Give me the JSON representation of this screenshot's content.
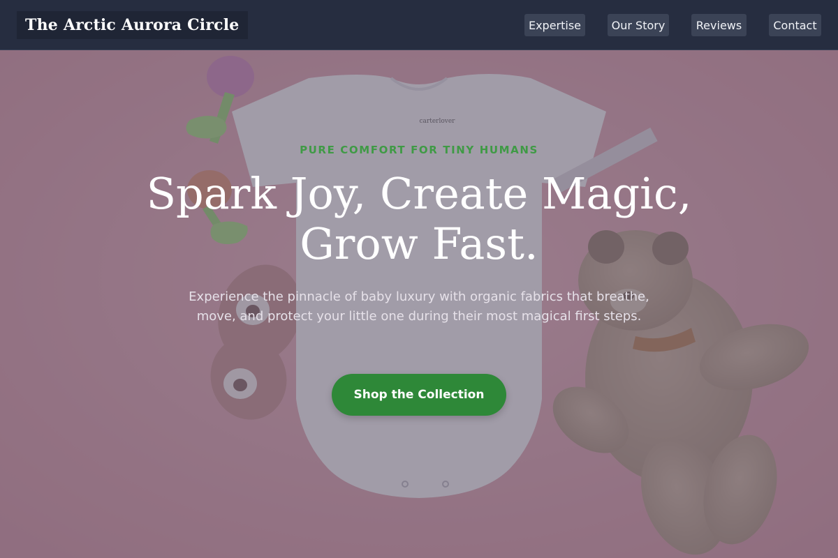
{
  "brand": {
    "name": "The Arctic Aurora Circle"
  },
  "nav": {
    "items": [
      {
        "label": "Expertise"
      },
      {
        "label": "Our Story"
      },
      {
        "label": "Reviews"
      },
      {
        "label": "Contact"
      }
    ]
  },
  "hero": {
    "eyebrow": "PURE COMFORT FOR TINY HUMANS",
    "headline_line1": "Spark Joy, Create Magic,",
    "headline_line2": "Grow Fast.",
    "subcopy": "Experience the pinnacle of baby luxury with organic fabrics that breathe, move, and protect your little one during their most magical first steps.",
    "cta_label": "Shop the Collection",
    "bodysuit_tag": "carterlover"
  },
  "colors": {
    "nav_background": "#262d40",
    "accent_green": "#2e8838",
    "eyebrow_green": "#3f9a45",
    "hero_pink": "#d59aa7"
  }
}
